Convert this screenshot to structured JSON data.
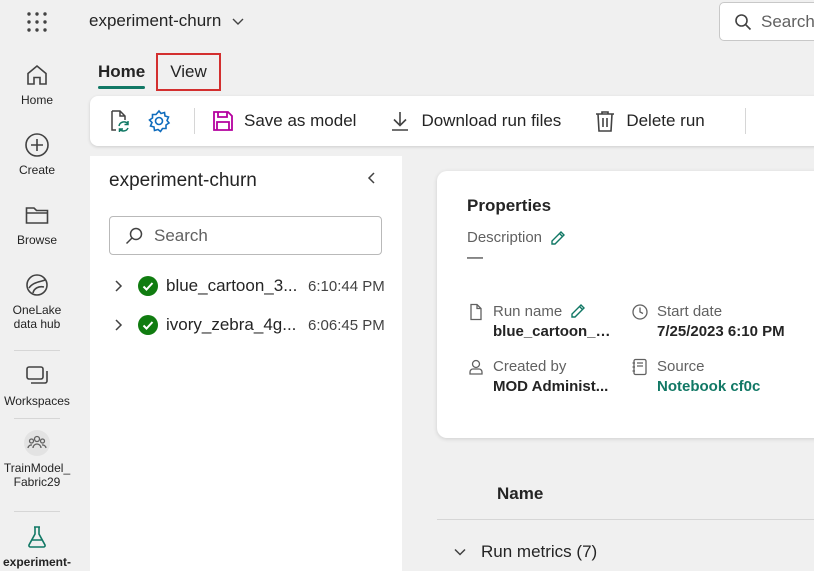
{
  "app": {
    "workspace_title": "experiment-churn",
    "search_placeholder": "Search"
  },
  "rail": {
    "items": [
      {
        "label": "Home",
        "icon": "home-icon"
      },
      {
        "label": "Create",
        "icon": "plus-circle-icon"
      },
      {
        "label": "Browse",
        "icon": "folder-icon"
      },
      {
        "label": "OneLake data hub",
        "icon": "onelake-icon"
      },
      {
        "label": "Workspaces",
        "icon": "workspaces-icon"
      },
      {
        "label": "TrainModel_ Fabric29",
        "icon": "people-icon"
      },
      {
        "label": "experiment-",
        "icon": "flask-icon"
      }
    ]
  },
  "tabs": [
    {
      "label": "Home",
      "active": true
    },
    {
      "label": "View",
      "active": false
    }
  ],
  "toolbar": {
    "save_model": "Save as model",
    "download": "Download run files",
    "delete": "Delete run"
  },
  "run_panel": {
    "title": "experiment-churn",
    "search_placeholder": "Search",
    "runs": [
      {
        "name": "blue_cartoon_3...",
        "time": "6:10:44 PM",
        "status": "success"
      },
      {
        "name": "ivory_zebra_4g...",
        "time": "6:06:45 PM",
        "status": "success"
      }
    ]
  },
  "properties": {
    "title": "Properties",
    "description_label": "Description",
    "description_value": "—",
    "run_name_label": "Run name",
    "run_name_value": "blue_cartoon_3...",
    "start_date_label": "Start date",
    "start_date_value": "7/25/2023 6:10 PM",
    "created_by_label": "Created by",
    "created_by_value": "MOD Administ...",
    "source_label": "Source",
    "source_value": "Notebook cf0c"
  },
  "metrics": {
    "name_header": "Name",
    "run_metrics_label": "Run metrics (7)"
  },
  "colors": {
    "accent": "#117865",
    "success": "#107c10",
    "highlight_box": "#d32f2f"
  }
}
